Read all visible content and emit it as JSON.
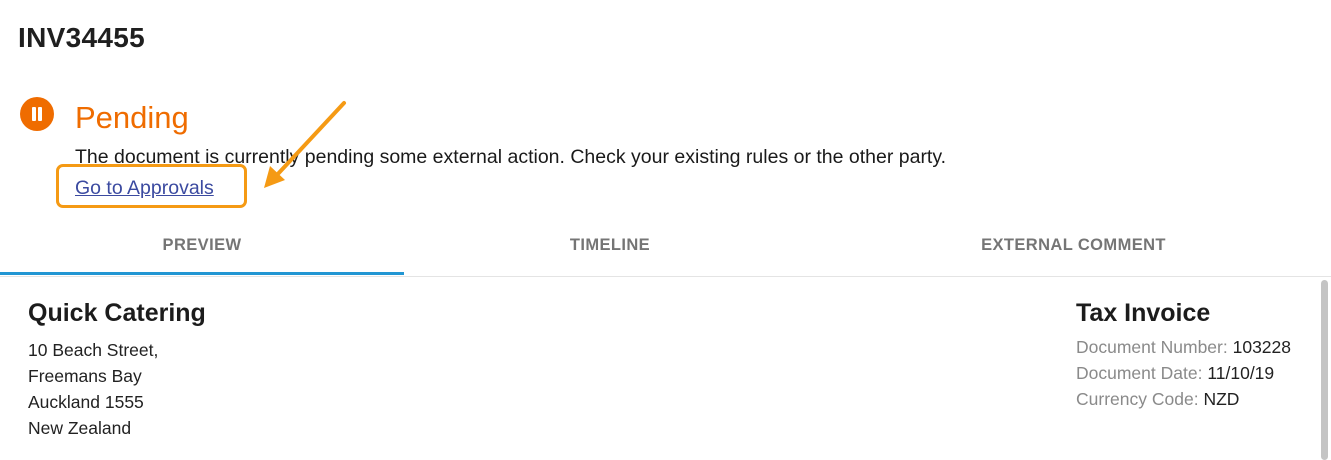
{
  "document": {
    "id": "INV34455"
  },
  "status": {
    "icon": "pause-icon",
    "color": "#ef6c00",
    "title": "Pending",
    "message": "The document is currently pending some external action. Check your existing rules or the other party.",
    "link_label": "Go to Approvals"
  },
  "annotation": {
    "color": "#f59a14",
    "icon": "arrow-icon"
  },
  "tabs": [
    {
      "label": "PREVIEW",
      "active": true
    },
    {
      "label": "TIMELINE",
      "active": false
    },
    {
      "label": "EXTERNAL COMMENT",
      "active": false
    }
  ],
  "tab_indicator_color": "#2196d3",
  "preview": {
    "company": "Quick Catering",
    "address": [
      "10 Beach Street,",
      "Freemans Bay",
      "Auckland 1555",
      "New Zealand"
    ],
    "invoice_title": "Tax Invoice",
    "fields": [
      {
        "label": "Document Number:",
        "value": "103228"
      },
      {
        "label": "Document Date:",
        "value": "11/10/19"
      },
      {
        "label": "Currency Code:",
        "value": "NZD"
      }
    ]
  }
}
